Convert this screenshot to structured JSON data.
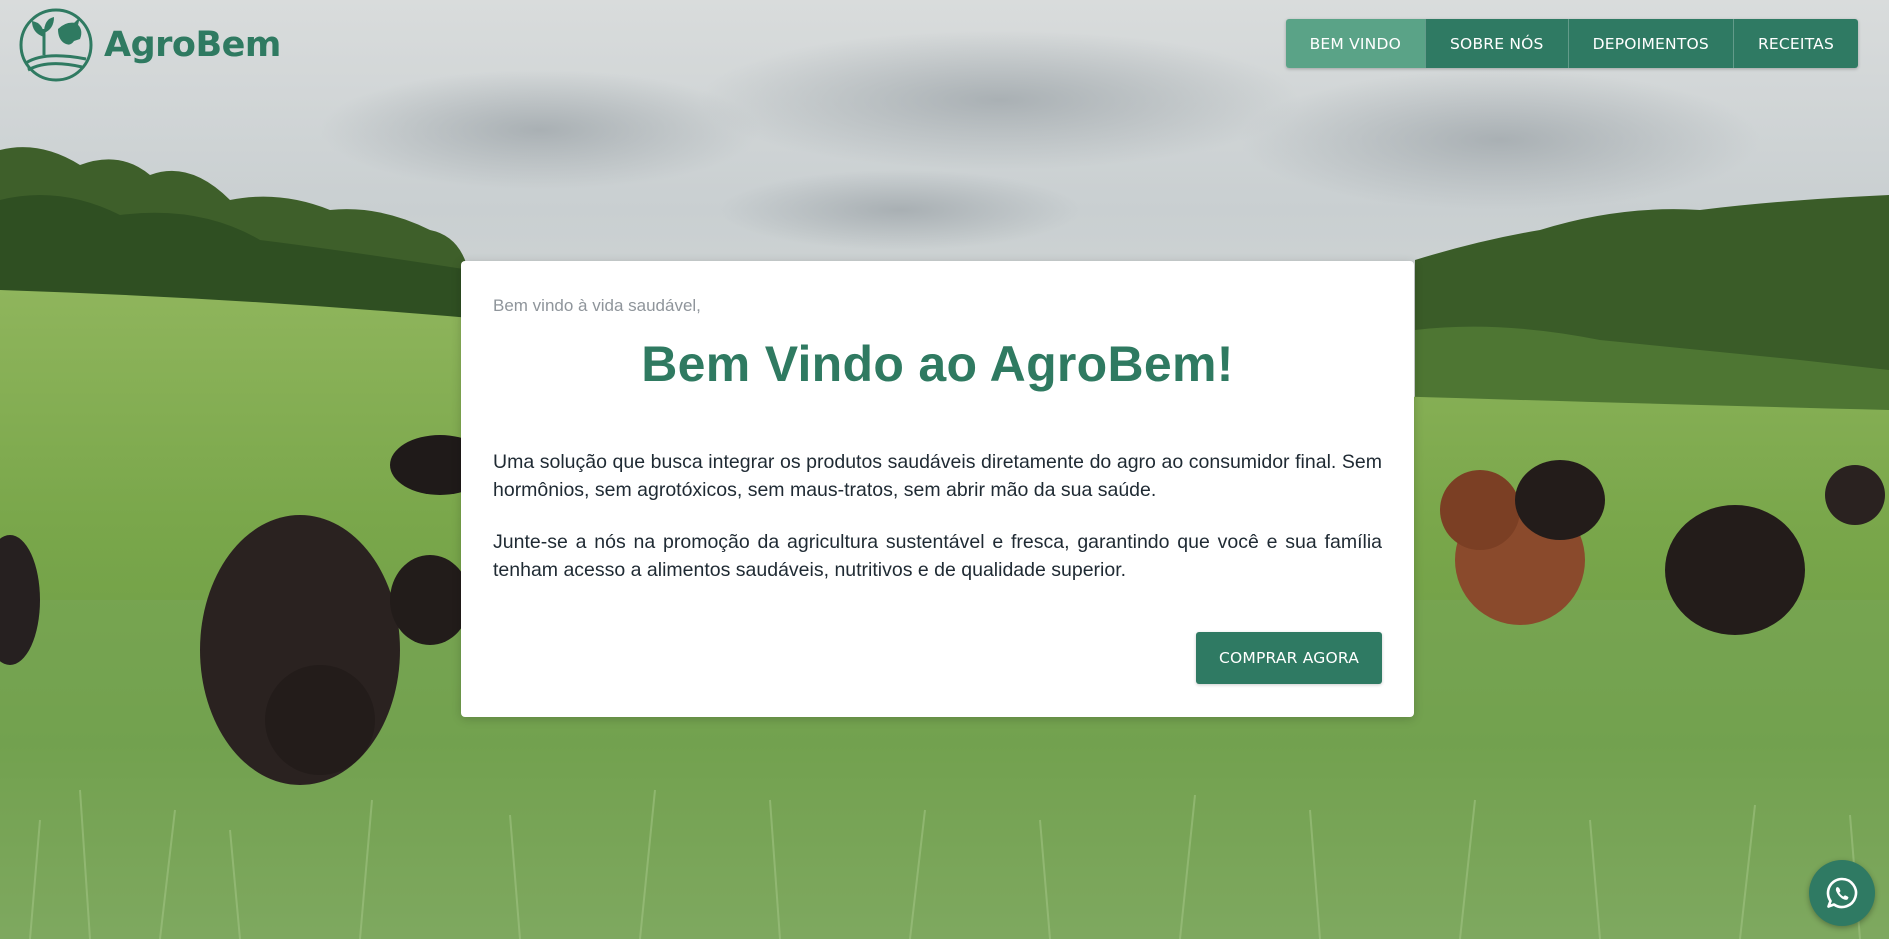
{
  "brand": {
    "name": "AgroBem",
    "logo_icon": "farm-leaf-cow-logo",
    "color": "#2f7a61"
  },
  "nav": {
    "items": [
      {
        "label": "BEM VINDO",
        "active": true
      },
      {
        "label": "SOBRE NÓS",
        "active": false
      },
      {
        "label": "DEPOIMENTOS",
        "active": false
      },
      {
        "label": "RECEITAS",
        "active": false
      }
    ],
    "color": "#2f7a63",
    "active_color": "#5aa387"
  },
  "hero": {
    "background": "cattle-grazing-on-green-pasture-photo",
    "card": {
      "kicker": "Bem vindo à vida saudável,",
      "title": "Bem Vindo ao AgroBem!",
      "paragraph_1": "Uma solução que busca integrar os produtos saudáveis diretamente do agro ao consumidor final. Sem hormônios, sem agrotóxicos, sem maus-tratos, sem abrir mão da sua saúde.",
      "paragraph_2": "Junte-se a nós na promoção da agricultura sustentável e fresca, garantindo que você e sua família tenham acesso a alimentos saudáveis, nutritivos e de qualidade superior.",
      "cta_label": "COMPRAR AGORA"
    }
  },
  "floating": {
    "whatsapp_icon": "whatsapp-icon"
  }
}
